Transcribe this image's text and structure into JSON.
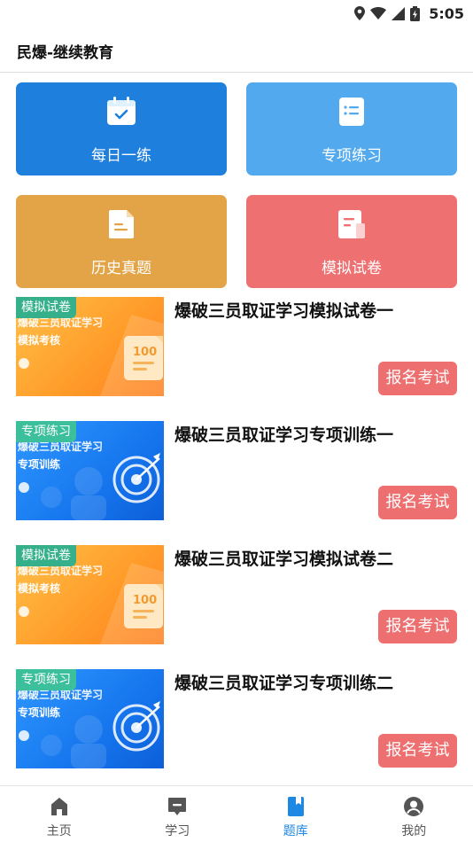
{
  "status_bar": {
    "time": "5:05"
  },
  "app_bar": {
    "title": "民爆-继续教育"
  },
  "categories": [
    {
      "label": "每日一练",
      "icon": "calendar-check-icon",
      "color": "#1e7fdc"
    },
    {
      "label": "专项练习",
      "icon": "list-icon",
      "color": "#52a9ee"
    },
    {
      "label": "历史真题",
      "icon": "document-icon",
      "color": "#e2a446"
    },
    {
      "label": "模拟试卷",
      "icon": "exam-paper-icon",
      "color": "#ee7070"
    }
  ],
  "exams": [
    {
      "tag": "模拟试卷",
      "thumb_line1": "爆破三员取证学习",
      "thumb_line2": "模拟考核",
      "title": "爆破三员取证学习模拟试卷一",
      "button": "报名考试",
      "thumb_score": "100"
    },
    {
      "tag": "专项练习",
      "thumb_line1": "爆破三员取证学习",
      "thumb_line2": "专项训练",
      "title": "爆破三员取证学习专项训练一",
      "button": "报名考试"
    },
    {
      "tag": "模拟试卷",
      "thumb_line1": "爆破三员取证学习",
      "thumb_line2": "模拟考核",
      "title": "爆破三员取证学习模拟试卷二",
      "button": "报名考试",
      "thumb_score": "100"
    },
    {
      "tag": "专项练习",
      "thumb_line1": "爆破三员取证学习",
      "thumb_line2": "专项训练",
      "title": "爆破三员取证学习专项训练二",
      "button": "报名考试"
    }
  ],
  "bottom_nav": [
    {
      "label": "主页",
      "icon": "home-icon",
      "active": false
    },
    {
      "label": "学习",
      "icon": "study-icon",
      "active": false
    },
    {
      "label": "题库",
      "icon": "question-bank-icon",
      "active": true
    },
    {
      "label": "我的",
      "icon": "profile-icon",
      "active": false
    }
  ],
  "colors": {
    "accent": "#1e88e5",
    "button": "#ee6f6f"
  }
}
